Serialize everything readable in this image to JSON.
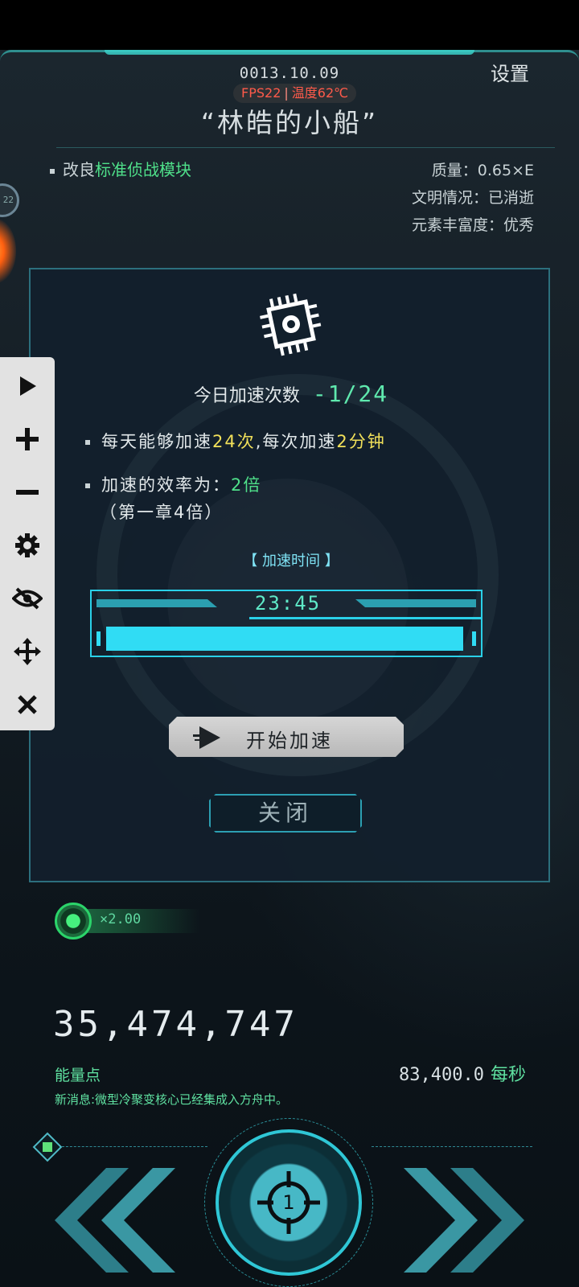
{
  "header": {
    "date": "0013.10.09",
    "fps": "FPS22",
    "temperature": "温度62℃",
    "ship_name": "“林皓的小船”",
    "settings_label": "设置"
  },
  "planet": {
    "module_prefix": "改良",
    "module_name": "标准侦战模块",
    "mass": "质量：0.65×E",
    "civilization": "文明情况：已消逝",
    "elements": "元素丰富度：优秀",
    "badge": "22"
  },
  "dialog": {
    "icon": "chip-icon",
    "count_label": "今日加速次数",
    "count_value": "-1/24",
    "rule1_a": "每天能够加速",
    "rule1_b": "24次",
    "rule1_c": ",每次加速",
    "rule1_d": "2分钟",
    "rule2_a": "加速的效率为：",
    "rule2_b": "2倍",
    "rule2_sub": "（第一章4倍）",
    "speed_time_label": "【 加速时间 】",
    "timer": "23:45",
    "progress_fraction": 0.99,
    "start_label": "开始加速",
    "close_label": "关闭"
  },
  "toolbar": {
    "items": [
      "play-icon",
      "plus-icon",
      "minus-icon",
      "gear-icon",
      "eye-off-icon",
      "move-icon",
      "close-icon"
    ]
  },
  "bottom": {
    "multiplier": "×2.00",
    "energy_value": "35,474,747",
    "energy_label": "能量点",
    "rate_value": "83,400.0",
    "rate_unit": "每秒",
    "message": "新消息:微型冷聚变核心已经集成入方舟中。",
    "center_number": "1"
  },
  "colors": {
    "accent_cyan": "#30dcf4",
    "accent_green": "#4fe08a",
    "highlight_yellow": "#f2e15a",
    "warning_red": "#ff5a4a"
  }
}
